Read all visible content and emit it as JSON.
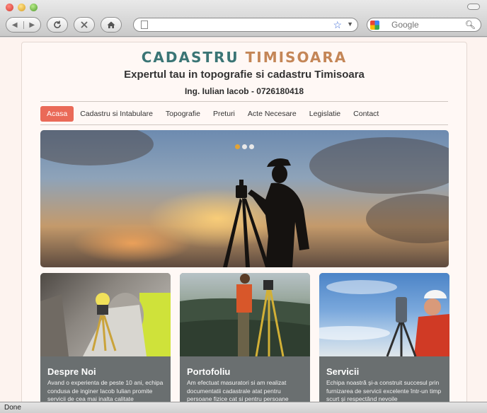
{
  "browser": {
    "search_placeholder": "Google",
    "status": "Done"
  },
  "site": {
    "logo_word1": "CADASTRU",
    "logo_word2": "TIMISOARA",
    "tagline": "Expertul tau in topografie si cadastru Timisoara",
    "contact": "Ing. Iulian Iacob - 0726180418"
  },
  "menu": [
    {
      "label": "Acasa"
    },
    {
      "label": "Cadastru si Intabulare"
    },
    {
      "label": "Topografie"
    },
    {
      "label": "Preturi"
    },
    {
      "label": "Acte Necesare"
    },
    {
      "label": "Legislatie"
    },
    {
      "label": "Contact"
    }
  ],
  "slider": {
    "active_index": 0,
    "count": 3
  },
  "tiles": [
    {
      "title": "Despre Noi",
      "text": "Avand o experienta de peste 10 ani, echipa condusa de inginer Iacob Iulian promite servicii de cea mai inalta calitate"
    },
    {
      "title": "Portofoliu",
      "text": "Am efectuat masuratori si am realizat documentatii cadastrale atat pentru persoane fizice cat si pentru persoane"
    },
    {
      "title": "Servicii",
      "text": "Echipa noastră și-a construit succesul prin furnizarea de servicii excelente într-un timp scurt și respectând nevoile"
    }
  ],
  "colors": {
    "accent": "#ea6a58",
    "logo_teal": "#3a7575",
    "logo_brown": "#c48657"
  }
}
